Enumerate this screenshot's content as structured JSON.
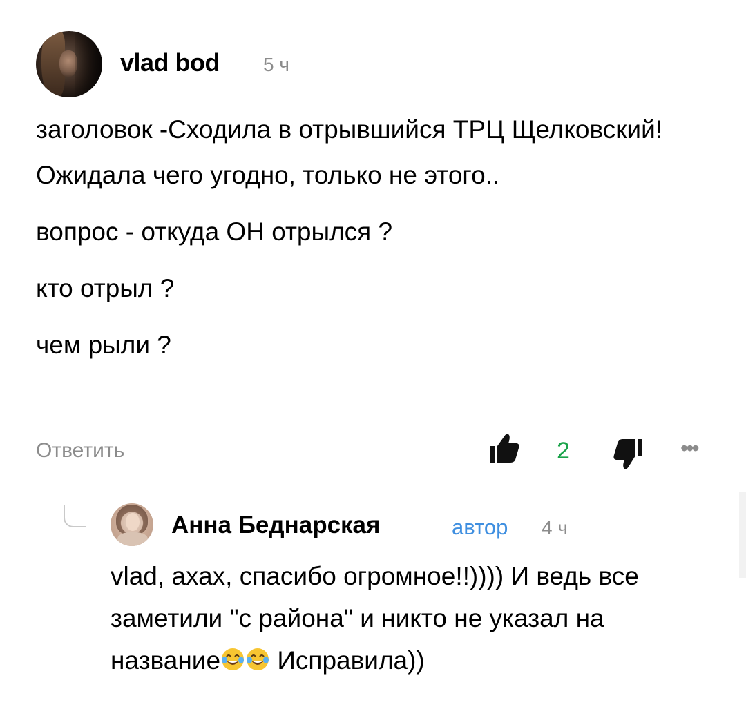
{
  "main_comment": {
    "author": "vlad bod",
    "time": "5 ч",
    "paragraphs": [
      "заголовок -Сходила в отрывшийся ТРЦ Щелковский! Ожидала чего угодно, только не этого..",
      "вопрос - откуда ОН отрылся ?",
      "кто отрыл ?",
      "чем рыли ?"
    ],
    "reply_label": "Ответить",
    "like_count": "2",
    "like_count_color": "#1aa34a",
    "more_label": "•••"
  },
  "reply": {
    "author": "Анна Беднарская",
    "badge": "автор",
    "badge_color": "#3f8fe0",
    "time": "4 ч",
    "text_part1": "vlad, ахах, спасибо огромное!!)))) И ведь все заметили \"с района\" и никто не указал на название",
    "text_part2": " Исправила))",
    "emojis": [
      "tears-of-joy-emoji",
      "tears-of-joy-emoji"
    ]
  },
  "icons": {
    "avatar_main": "user-avatar",
    "like": "thumbs-up-icon",
    "dislike": "thumbs-down-icon",
    "more": "more-options-icon"
  }
}
